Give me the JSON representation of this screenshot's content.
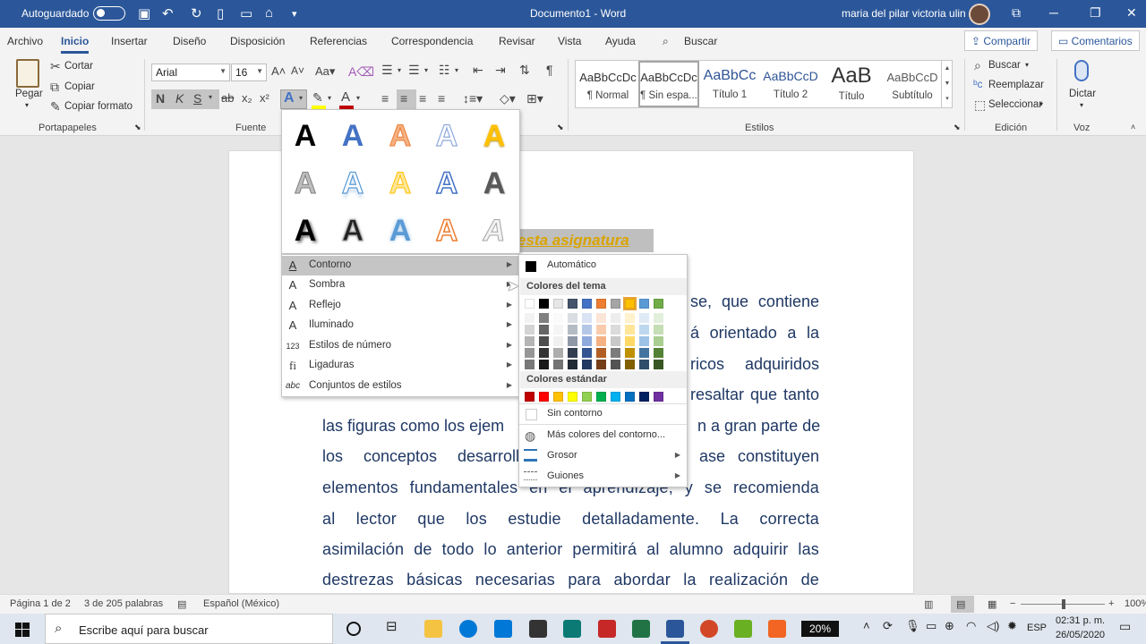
{
  "titlebar": {
    "autosave_label": "Autoguardado",
    "doc_title": "Documento1  -  Word",
    "user_name": "maria del pilar victoria ulin"
  },
  "tabs": [
    "Archivo",
    "Inicio",
    "Insertar",
    "Diseño",
    "Disposición",
    "Referencias",
    "Correspondencia",
    "Revisar",
    "Vista",
    "Ayuda"
  ],
  "tell_me": "Buscar",
  "share_label": "Compartir",
  "comments_label": "Comentarios",
  "ribbon": {
    "clipboard": {
      "paste": "Pegar",
      "cut": "Cortar",
      "copy": "Copiar",
      "format_painter": "Copiar formato",
      "group": "Portapapeles"
    },
    "font": {
      "name": "Arial",
      "size": "16",
      "group": "Fuente"
    },
    "styles": {
      "items": [
        {
          "preview": "AaBbCcDc",
          "name": "¶ Normal"
        },
        {
          "preview": "AaBbCcDc",
          "name": "¶ Sin espa..."
        },
        {
          "preview": "AaBbCc",
          "name": "Título 1"
        },
        {
          "preview": "AaBbCcD",
          "name": "Título 2"
        },
        {
          "preview": "AaB",
          "name": "Título"
        },
        {
          "preview": "AaBbCcD",
          "name": "Subtítulo"
        }
      ],
      "group": "Estilos"
    },
    "editing": {
      "find": "Buscar",
      "replace": "Reemplazar",
      "select": "Seleccionar",
      "group": "Edición"
    },
    "voice": {
      "dictate": "Dictar",
      "group": "Voz"
    }
  },
  "document": {
    "highlighted_text": "esta asignatura",
    "lines": [
      "se,  que  contiene",
      "á  orientado  a  la",
      "ricos  adquiridos",
      "resaltar  que  tanto",
      "las figuras como los ejem",
      "n a gran parte de",
      "los  conceptos  desarroll",
      "ase  constituyen",
      "elementos fundamentales en el aprendizaje, y se recomienda",
      "al    lector    que    los    estudie    detalladamente.    La    correcta",
      "asimilación de todo lo anterior permitirá al alumno adquirir las",
      "destrezas  básicas  necesarias  para  abordar  la  realización  de"
    ]
  },
  "text_effects_menu": {
    "items": [
      {
        "label": "Contorno",
        "icon": "A"
      },
      {
        "label": "Sombra",
        "icon": "A"
      },
      {
        "label": "Reflejo",
        "icon": "A"
      },
      {
        "label": "Iluminado",
        "icon": "A"
      },
      {
        "label": "Estilos de número",
        "icon": "123"
      },
      {
        "label": "Ligaduras",
        "icon": "fi"
      },
      {
        "label": "Conjuntos de estilos",
        "icon": "abc"
      }
    ]
  },
  "outline_palette": {
    "automatic": "Automático",
    "theme_header": "Colores del tema",
    "standard_header": "Colores estándar",
    "no_outline": "Sin contorno",
    "more_colors": "Más colores del contorno...",
    "weight": "Grosor",
    "dashes": "Guiones",
    "theme_colors": [
      "#ffffff",
      "#000000",
      "#e7e6e6",
      "#44546a",
      "#4472c4",
      "#ed7d31",
      "#a5a5a5",
      "#ffc000",
      "#5b9bd5",
      "#70ad47"
    ],
    "standard_colors": [
      "#c00000",
      "#ff0000",
      "#ffc000",
      "#ffff00",
      "#92d050",
      "#00b050",
      "#00b0f0",
      "#0070c0",
      "#002060",
      "#7030a0"
    ]
  },
  "status": {
    "page": "Página 1 de 2",
    "words": "3 de 205 palabras",
    "language": "Español (México)",
    "zoom": "100%"
  },
  "taskbar": {
    "search_placeholder": "Escribe aquí para buscar",
    "battery": "20%",
    "lang": "ESP",
    "time": "02:31 p. m.",
    "date": "26/05/2020"
  }
}
